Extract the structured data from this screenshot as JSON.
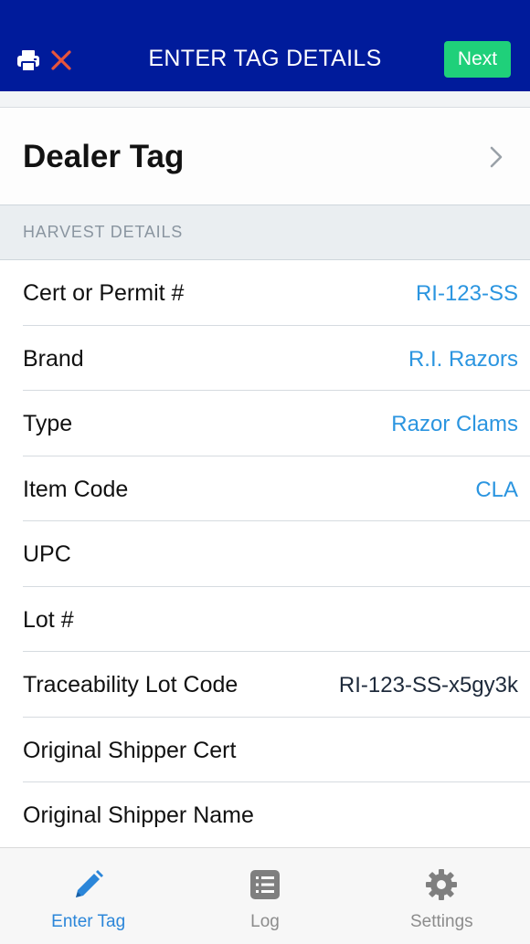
{
  "header": {
    "title": "ENTER TAG DETAILS",
    "next_label": "Next",
    "left_icons": [
      "print-icon",
      "close-icon"
    ],
    "colors": {
      "bar": "#001b9b",
      "next": "#1fd07a",
      "close": "#e8553c"
    }
  },
  "dealer": {
    "label": "Dealer Tag",
    "icon": "chevron-right-icon"
  },
  "section": {
    "title": "HARVEST DETAILS"
  },
  "rows": [
    {
      "label": "Cert or Permit #",
      "value": "RI-123-SS"
    },
    {
      "label": "Brand",
      "value": "R.I. Razors"
    },
    {
      "label": "Type",
      "value": "Razor Clams"
    },
    {
      "label": "Item Code",
      "value": "CLA"
    },
    {
      "label": "UPC",
      "value": ""
    },
    {
      "label": "Lot #",
      "value": ""
    },
    {
      "label": "Traceability Lot Code",
      "value": "RI-123-SS-x5gy3k"
    },
    {
      "label": "Original Shipper Cert",
      "value": ""
    },
    {
      "label": "Original Shipper Name",
      "value": ""
    }
  ],
  "tabs": [
    {
      "label": "Enter Tag",
      "icon": "pencil-icon",
      "active": true
    },
    {
      "label": "Log",
      "icon": "list-icon",
      "active": false
    },
    {
      "label": "Settings",
      "icon": "gear-icon",
      "active": false
    }
  ],
  "accent_color": "#2b86d9"
}
